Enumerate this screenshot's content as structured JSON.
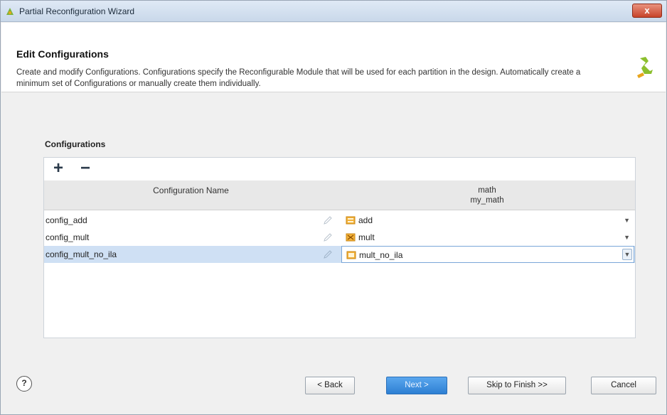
{
  "window": {
    "title": "Partial Reconfiguration Wizard",
    "close_glyph": "x"
  },
  "header": {
    "heading": "Edit Configurations",
    "description": "Create and modify Configurations. Configurations specify the Reconfigurable Module that will be used for each partition in the design. Automatically create a minimum set of Configurations or manually create them individually."
  },
  "configurations": {
    "section_label": "Configurations",
    "toolbar": {
      "add_glyph": "+",
      "remove_glyph": "−"
    },
    "columns": {
      "name": "Configuration Name",
      "partition_line1": "math",
      "partition_line2": "my_math"
    },
    "rows": [
      {
        "name": "config_add",
        "module": "add",
        "selected": false
      },
      {
        "name": "config_mult",
        "module": "mult",
        "selected": false
      },
      {
        "name": "config_mult_no_ila",
        "module": "mult_no_ila",
        "selected": true
      }
    ]
  },
  "footer": {
    "help_glyph": "?",
    "back": "< Back",
    "next": "Next >",
    "skip": "Skip to Finish >>",
    "cancel": "Cancel"
  },
  "colors": {
    "selection": "#cfe0f4",
    "accent_button": "#2d7fd3"
  },
  "icons": [
    "wizard-icon",
    "close-icon",
    "brand-logo-icon",
    "add-icon",
    "remove-icon",
    "edit-pencil-icon",
    "module-icon",
    "dropdown-arrow-icon",
    "help-icon"
  ]
}
